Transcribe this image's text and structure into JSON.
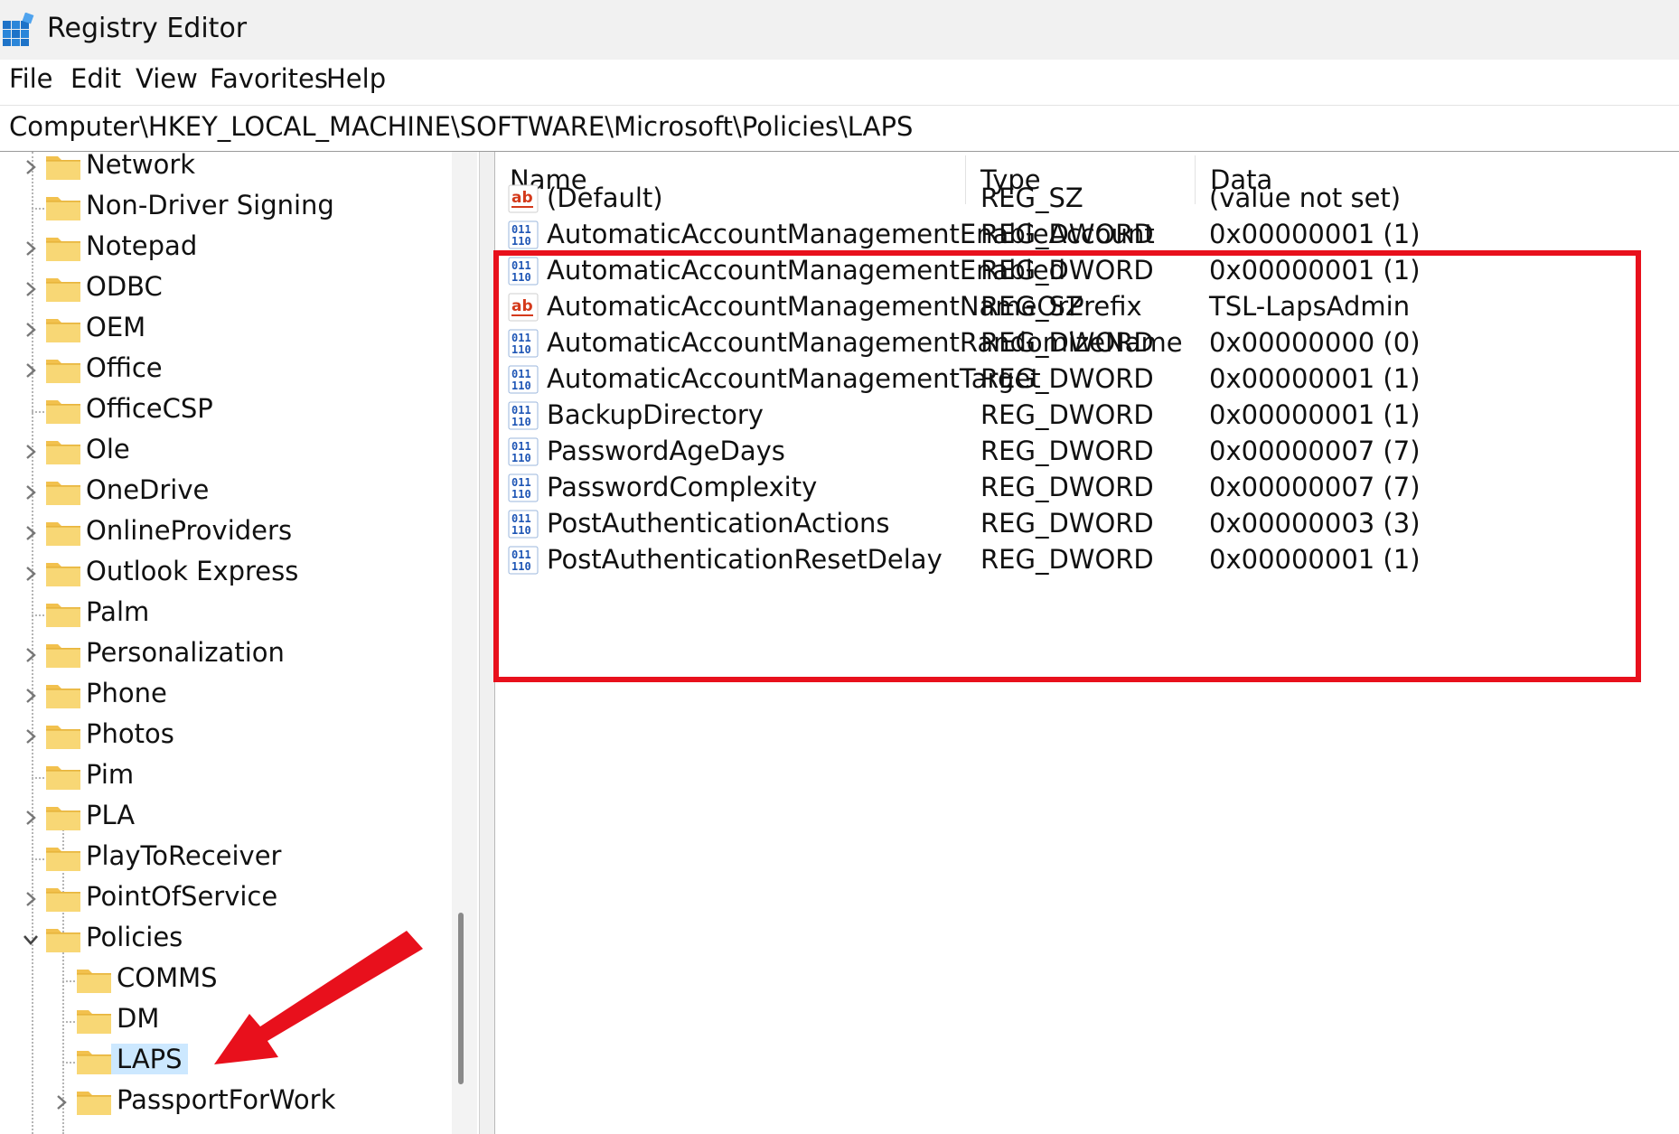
{
  "window": {
    "title": "Registry Editor",
    "app_icon": "registry-editor-icon"
  },
  "menu": [
    "File",
    "Edit",
    "View",
    "Favorites",
    "Help"
  ],
  "address": "Computer\\HKEY_LOCAL_MACHINE\\SOFTWARE\\Microsoft\\Policies\\LAPS",
  "tree": {
    "items": [
      {
        "label": "Network",
        "expander": "collapsed"
      },
      {
        "label": "Non-Driver Signing",
        "expander": "none"
      },
      {
        "label": "Notepad",
        "expander": "collapsed"
      },
      {
        "label": "ODBC",
        "expander": "collapsed"
      },
      {
        "label": "OEM",
        "expander": "collapsed"
      },
      {
        "label": "Office",
        "expander": "collapsed"
      },
      {
        "label": "OfficeCSP",
        "expander": "none"
      },
      {
        "label": "Ole",
        "expander": "collapsed"
      },
      {
        "label": "OneDrive",
        "expander": "collapsed"
      },
      {
        "label": "OnlineProviders",
        "expander": "collapsed"
      },
      {
        "label": "Outlook Express",
        "expander": "collapsed"
      },
      {
        "label": "Palm",
        "expander": "none"
      },
      {
        "label": "Personalization",
        "expander": "collapsed"
      },
      {
        "label": "Phone",
        "expander": "collapsed"
      },
      {
        "label": "Photos",
        "expander": "collapsed"
      },
      {
        "label": "Pim",
        "expander": "none"
      },
      {
        "label": "PLA",
        "expander": "collapsed"
      },
      {
        "label": "PlayToReceiver",
        "expander": "none"
      },
      {
        "label": "PointOfService",
        "expander": "collapsed"
      },
      {
        "label": "Policies",
        "expander": "expanded"
      },
      {
        "label": "COMMS",
        "expander": "none",
        "child": true
      },
      {
        "label": "DM",
        "expander": "none",
        "child": true
      },
      {
        "label": "LAPS",
        "expander": "none",
        "child": true,
        "selected": true
      },
      {
        "label": "PassportForWork",
        "expander": "collapsed",
        "child": true
      }
    ]
  },
  "list": {
    "columns": [
      "Name",
      "Type",
      "Data"
    ],
    "rows": [
      {
        "icon": "string-value-icon",
        "name": "(Default)",
        "type": "REG_SZ",
        "data": "(value not set)"
      },
      {
        "icon": "binary-value-icon",
        "name": "AutomaticAccountManagementEnableAccount",
        "type": "REG_DWORD",
        "data": "0x00000001 (1)"
      },
      {
        "icon": "binary-value-icon",
        "name": "AutomaticAccountManagementEnabled",
        "type": "REG_DWORD",
        "data": "0x00000001 (1)"
      },
      {
        "icon": "string-value-icon",
        "name": "AutomaticAccountManagementNameOrPrefix",
        "type": "REG_SZ",
        "data": "TSL-LapsAdmin"
      },
      {
        "icon": "binary-value-icon",
        "name": "AutomaticAccountManagementRandomizeName",
        "type": "REG_DWORD",
        "data": "0x00000000 (0)"
      },
      {
        "icon": "binary-value-icon",
        "name": "AutomaticAccountManagementTarget",
        "type": "REG_DWORD",
        "data": "0x00000001 (1)"
      },
      {
        "icon": "binary-value-icon",
        "name": "BackupDirectory",
        "type": "REG_DWORD",
        "data": "0x00000001 (1)"
      },
      {
        "icon": "binary-value-icon",
        "name": "PasswordAgeDays",
        "type": "REG_DWORD",
        "data": "0x00000007 (7)"
      },
      {
        "icon": "binary-value-icon",
        "name": "PasswordComplexity",
        "type": "REG_DWORD",
        "data": "0x00000007 (7)"
      },
      {
        "icon": "binary-value-icon",
        "name": "PostAuthenticationActions",
        "type": "REG_DWORD",
        "data": "0x00000003 (3)"
      },
      {
        "icon": "binary-value-icon",
        "name": "PostAuthenticationResetDelay",
        "type": "REG_DWORD",
        "data": "0x00000001 (1)"
      }
    ]
  },
  "annotations": {
    "highlight_color": "#e8101c",
    "arrow_color": "#e8101c"
  }
}
